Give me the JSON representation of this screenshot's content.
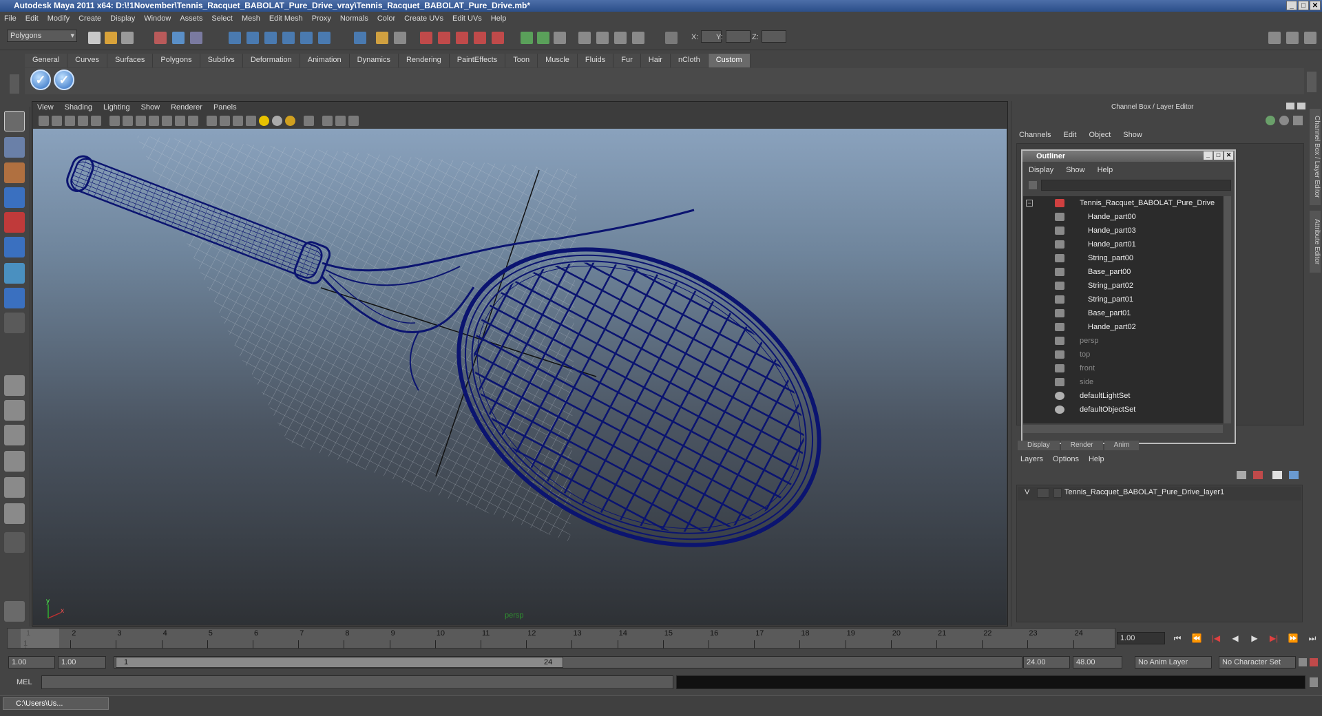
{
  "window": {
    "title": "Autodesk Maya 2011 x64: D:\\!1November\\Tennis_Racquet_BABOLAT_Pure_Drive_vray\\Tennis_Racquet_BABOLAT_Pure_Drive.mb*",
    "min": "_",
    "max": "□",
    "close": "✕"
  },
  "menu": [
    "File",
    "Edit",
    "Modify",
    "Create",
    "Display",
    "Window",
    "Assets",
    "Select",
    "Mesh",
    "Edit Mesh",
    "Proxy",
    "Normals",
    "Color",
    "Create UVs",
    "Edit UVs",
    "Help"
  ],
  "status_line": {
    "mode": "Polygons",
    "x_label": "X:",
    "y_label": "Y:",
    "z_label": "Z:"
  },
  "shelf": {
    "tabs": [
      "General",
      "Curves",
      "Surfaces",
      "Polygons",
      "Subdivs",
      "Deformation",
      "Animation",
      "Dynamics",
      "Rendering",
      "PaintEffects",
      "Toon",
      "Muscle",
      "Fluids",
      "Fur",
      "Hair",
      "nCloth",
      "Custom"
    ],
    "active": "Custom"
  },
  "viewport": {
    "menu": [
      "View",
      "Shading",
      "Lighting",
      "Show",
      "Renderer",
      "Panels"
    ],
    "camera_label": "persp",
    "axis_x": "x",
    "axis_y": "y",
    "wire_color": "#0b1470"
  },
  "channel_box": {
    "title": "Channel Box / Layer Editor",
    "menu": [
      "Channels",
      "Edit",
      "Object",
      "Show"
    ]
  },
  "outliner": {
    "title": "Outliner",
    "menu": [
      "Display",
      "Show",
      "Help"
    ],
    "items": [
      {
        "label": "Tennis_Racquet_BABOLAT_Pure_Drive",
        "kind": "group",
        "dim": false
      },
      {
        "label": "Hande_part00",
        "kind": "mesh",
        "dim": false
      },
      {
        "label": "Hande_part03",
        "kind": "mesh",
        "dim": false
      },
      {
        "label": "Hande_part01",
        "kind": "mesh",
        "dim": false
      },
      {
        "label": "String_part00",
        "kind": "mesh",
        "dim": false
      },
      {
        "label": "Base_part00",
        "kind": "mesh",
        "dim": false
      },
      {
        "label": "String_part02",
        "kind": "mesh",
        "dim": false
      },
      {
        "label": "String_part01",
        "kind": "mesh",
        "dim": false
      },
      {
        "label": "Base_part01",
        "kind": "mesh",
        "dim": false
      },
      {
        "label": "Hande_part02",
        "kind": "mesh",
        "dim": false
      },
      {
        "label": "persp",
        "kind": "camera",
        "dim": true
      },
      {
        "label": "top",
        "kind": "camera",
        "dim": true
      },
      {
        "label": "front",
        "kind": "camera",
        "dim": true
      },
      {
        "label": "side",
        "kind": "camera",
        "dim": true
      },
      {
        "label": "defaultLightSet",
        "kind": "set",
        "dim": false
      },
      {
        "label": "defaultObjectSet",
        "kind": "set",
        "dim": false
      }
    ]
  },
  "layer_editor": {
    "tabs": [
      "Display",
      "Render",
      "Anim"
    ],
    "menu": [
      "Layers",
      "Options",
      "Help"
    ],
    "layer_visible": "V",
    "layer_name": "Tennis_Racquet_BABOLAT_Pure_Drive_layer1"
  },
  "side_tabs": [
    "Channel Box / Layer Editor",
    "Attribute Editor"
  ],
  "timeline": {
    "ticks": [
      "1",
      "2",
      "3",
      "4",
      "5",
      "6",
      "7",
      "8",
      "9",
      "10",
      "11",
      "12",
      "13",
      "14",
      "15",
      "16",
      "17",
      "18",
      "19",
      "20",
      "21",
      "22",
      "23",
      "24"
    ],
    "current_marker": "1",
    "current_frame": "1.00",
    "play_buttons": [
      "⏮",
      "⏪",
      "|◀",
      "◀",
      "▶",
      "▶|",
      "⏩",
      "⏭"
    ]
  },
  "range": {
    "start": "1.00",
    "start2": "1.00",
    "handle_start": "1",
    "handle_end": "24",
    "end": "24.00",
    "end2": "48.00",
    "anim_layer": "No Anim Layer",
    "char_set": "No Character Set"
  },
  "command": {
    "label": "MEL"
  },
  "taskbar": {
    "item": "C:\\Users\\Us..."
  }
}
